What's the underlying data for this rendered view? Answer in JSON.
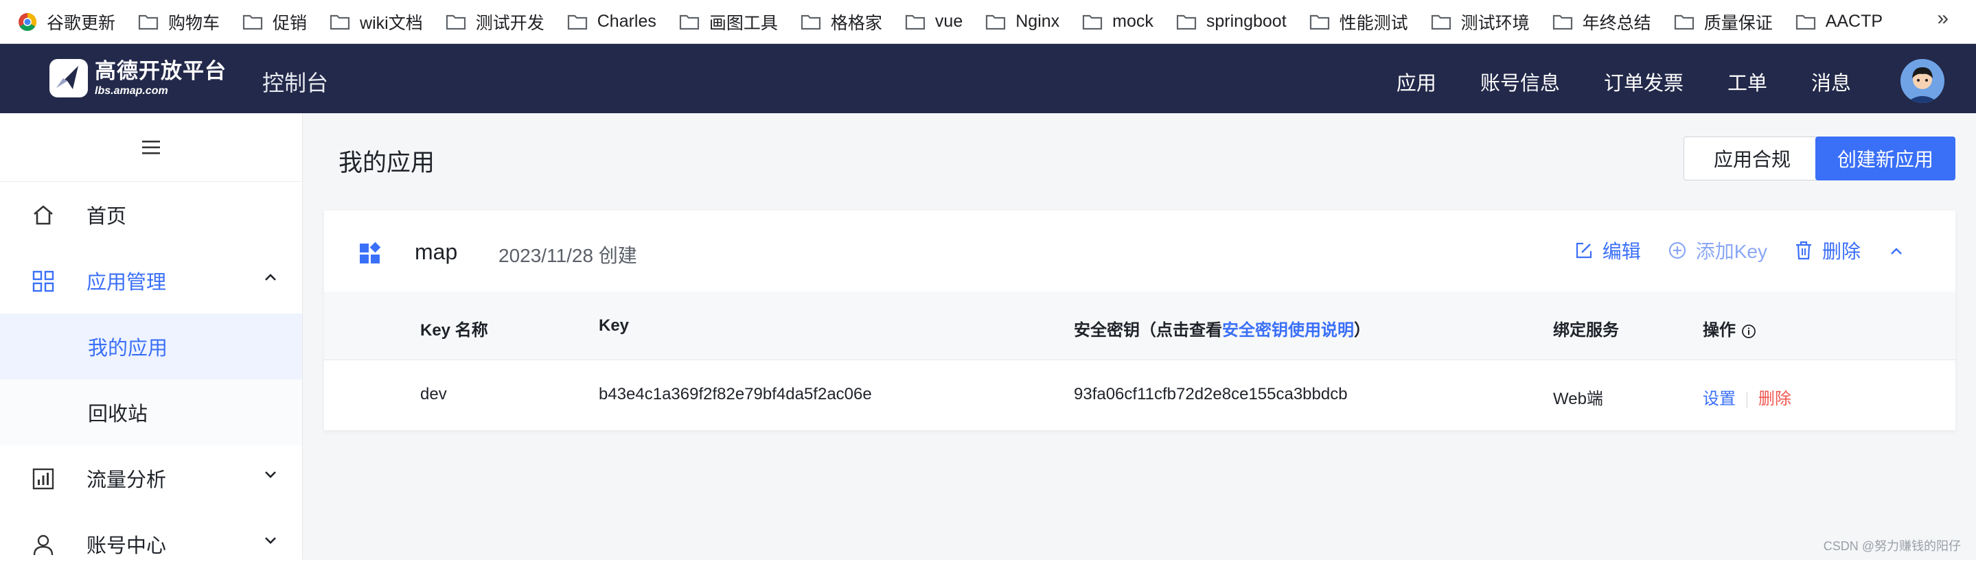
{
  "bookmarks": {
    "items": [
      {
        "label": "谷歌更新",
        "icon": "chrome-icon"
      },
      {
        "label": "购物车",
        "icon": "folder-icon"
      },
      {
        "label": "促销",
        "icon": "folder-icon"
      },
      {
        "label": "wiki文档",
        "icon": "folder-icon"
      },
      {
        "label": "测试开发",
        "icon": "folder-icon"
      },
      {
        "label": "Charles",
        "icon": "folder-icon"
      },
      {
        "label": "画图工具",
        "icon": "folder-icon"
      },
      {
        "label": "格格家",
        "icon": "folder-icon"
      },
      {
        "label": "vue",
        "icon": "folder-icon"
      },
      {
        "label": "Nginx",
        "icon": "folder-icon"
      },
      {
        "label": "mock",
        "icon": "folder-icon"
      },
      {
        "label": "springboot",
        "icon": "folder-icon"
      },
      {
        "label": "性能测试",
        "icon": "folder-icon"
      },
      {
        "label": "测试环境",
        "icon": "folder-icon"
      },
      {
        "label": "年终总结",
        "icon": "folder-icon"
      },
      {
        "label": "质量保证",
        "icon": "folder-icon"
      },
      {
        "label": "AACTP",
        "icon": "folder-icon"
      }
    ],
    "more": "»"
  },
  "topnav": {
    "logo_cn": "高德开放平台",
    "logo_en": "lbs.amap.com",
    "console": "控制台",
    "links": [
      "应用",
      "账号信息",
      "订单发票",
      "工单",
      "消息"
    ]
  },
  "sidebar": {
    "toggle_icon": "menu-icon",
    "items": [
      {
        "label": "首页",
        "icon": "home-icon"
      },
      {
        "label": "应用管理",
        "icon": "grid-icon"
      },
      {
        "label": "我的应用"
      },
      {
        "label": "回收站"
      },
      {
        "label": "流量分析",
        "icon": "chart-icon"
      },
      {
        "label": "账号中心",
        "icon": "user-icon"
      }
    ]
  },
  "main": {
    "title": "我的应用",
    "compliance_button": "应用合规",
    "create_button": "创建新应用"
  },
  "app": {
    "name": "map",
    "created": "2023/11/28 创建",
    "actions": {
      "edit": "编辑",
      "add_key": "添加Key",
      "delete": "删除"
    },
    "table": {
      "headers": {
        "key_name": "Key 名称",
        "key": "Key",
        "secret_prefix": "安全密钥（点击查看",
        "secret_link": "安全密钥使用说明",
        "secret_suffix": "）",
        "service": "绑定服务",
        "ops": "操作"
      },
      "rows": [
        {
          "key_name": "dev",
          "key": "b43e4c1a369f2f82e79bf4da5f2ac06e",
          "secret": "93fa06cf11cfb72d2e8ce155ca3bbdcb",
          "service": "Web端",
          "op_settings": "设置",
          "op_delete": "删除"
        }
      ]
    }
  },
  "watermark": "CSDN @努力赚钱的阳仔",
  "colors": {
    "nav_bg": "#23294a",
    "accent": "#3a6ff7",
    "danger": "#f0564e",
    "selected_bg": "#eef3ff"
  }
}
